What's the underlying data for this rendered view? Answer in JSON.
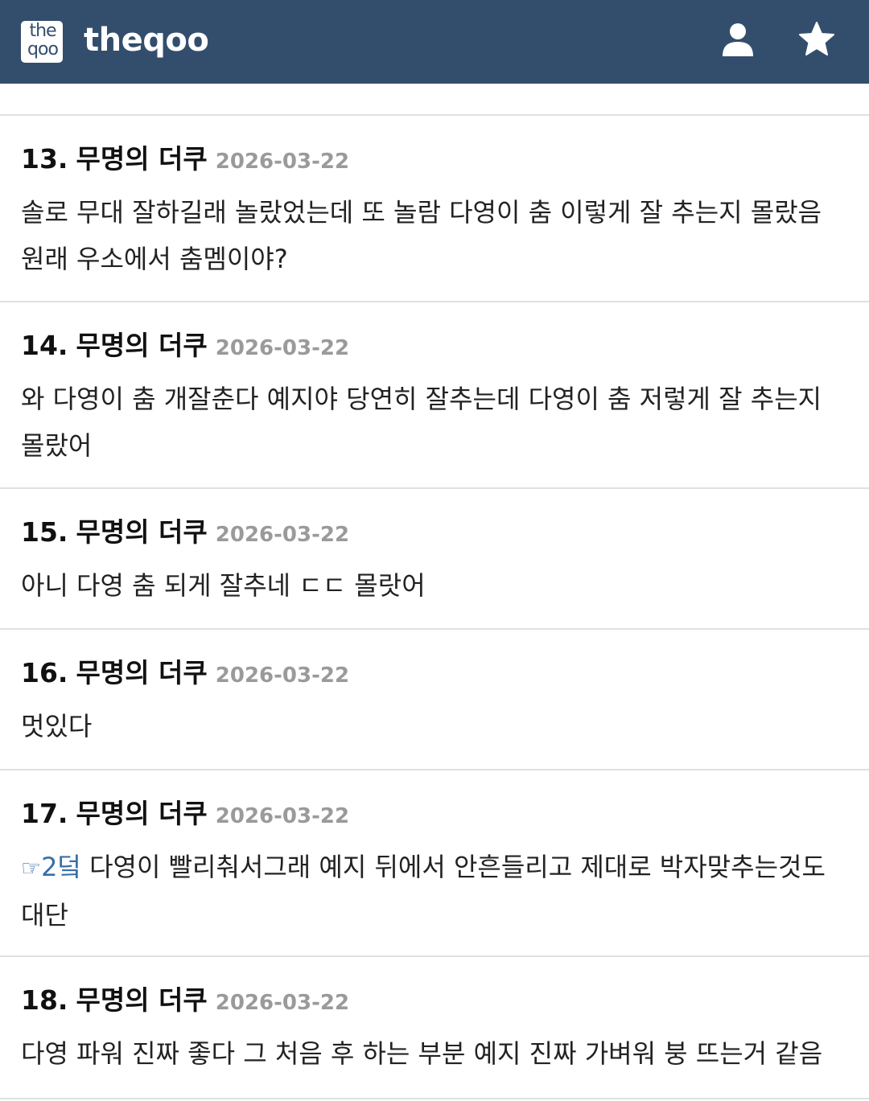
{
  "header": {
    "logo_line1": "the",
    "logo_line2": "qoo",
    "site_name": "theqoo",
    "icons": [
      "user-icon",
      "star-icon"
    ],
    "background_color": "#334e6d"
  },
  "comments": [
    {
      "number": "13.",
      "author": "무명의 더쿠",
      "date": "2026-03-22",
      "text": "솔로 무대 잘하길래 놀랐었는데 또 놀람 다영이 춤 이렇게 잘 추는지 몰랐음 원래 우소에서 춤멤이야?"
    },
    {
      "number": "14.",
      "author": "무명의 더쿠",
      "date": "2026-03-22",
      "text": "와 다영이 춤 개잘춘다 예지야 당연히 잘추는데 다영이 춤 저렇게 잘 추는지 몰랐어"
    },
    {
      "number": "15.",
      "author": "무명의 더쿠",
      "date": "2026-03-22",
      "text": "아니 다영 춤 되게 잘추네 ㄷㄷ 몰랏어"
    },
    {
      "number": "16.",
      "author": "무명의 더쿠",
      "date": "2026-03-22",
      "text": "멋있다"
    },
    {
      "number": "17.",
      "author": "무명의 더쿠",
      "date": "2026-03-22",
      "reply_hand": "☞",
      "reply_to": "2덬",
      "text": " 다영이 빨리춰서그래 예지 뒤에서 안흔들리고 제대로 박자맞추는것도 대단"
    },
    {
      "number": "18.",
      "author": "무명의 더쿠",
      "date": "2026-03-22",
      "text": "다영 파워 진짜 좋다 그 처음 후 하는 부분 예지 진짜 가벼워 붕 뜨는거 같음"
    }
  ]
}
